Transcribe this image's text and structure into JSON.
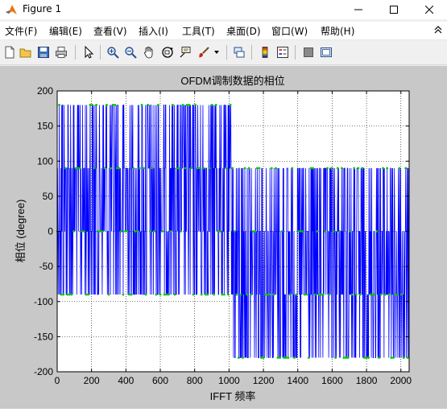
{
  "window": {
    "title": "Figure 1",
    "controls": {
      "minimize": "—",
      "maximize": "☐",
      "close": "✕"
    }
  },
  "menu": {
    "items": [
      {
        "label": "文件(F)"
      },
      {
        "label": "编辑(E)"
      },
      {
        "label": "查看(V)"
      },
      {
        "label": "插入(I)"
      },
      {
        "label": "工具(T)"
      },
      {
        "label": "桌面(D)"
      },
      {
        "label": "窗口(W)"
      },
      {
        "label": "帮助(H)"
      }
    ],
    "overflow_icon": "double-chevron-up-icon"
  },
  "toolbar": {
    "icons": [
      "new-figure-icon",
      "open-file-icon",
      "save-icon",
      "print-icon",
      "edit-plot-arrow-icon",
      "zoom-in-icon",
      "zoom-out-icon",
      "pan-hand-icon",
      "rotate-3d-icon",
      "data-cursor-icon",
      "brush-icon",
      "brush-dropdown-icon",
      "link-plot-icon",
      "colorbar-icon",
      "legend-icon",
      "hide-plot-tools-icon",
      "show-plot-tools-icon"
    ]
  },
  "colors": {
    "figure_bg": "#c8c8c8",
    "axes_bg": "#ffffff",
    "line": "#0000ff",
    "marker": "#00c800"
  },
  "chart_data": {
    "type": "line",
    "title": "OFDM调制数据的相位",
    "xlabel": "IFFT 频率",
    "ylabel": "相位 (degree)",
    "xlim": [
      0,
      2048
    ],
    "ylim": [
      -200,
      200
    ],
    "xticks": [
      0,
      200,
      400,
      600,
      800,
      1000,
      1200,
      1400,
      1600,
      1800,
      2000
    ],
    "yticks": [
      -200,
      -150,
      -100,
      -50,
      0,
      50,
      100,
      150,
      200
    ],
    "grid": true,
    "series": [
      {
        "description_points": [
          {
            "x_range": [
              0,
              1024
            ],
            "levels": [
              180,
              90,
              0,
              -90
            ]
          },
          {
            "x_range": [
              1024,
              2048
            ],
            "levels": [
              90,
              0,
              -90,
              -180
            ]
          }
        ],
        "sample_points_per_segment": 1024,
        "marker": "*"
      }
    ]
  }
}
